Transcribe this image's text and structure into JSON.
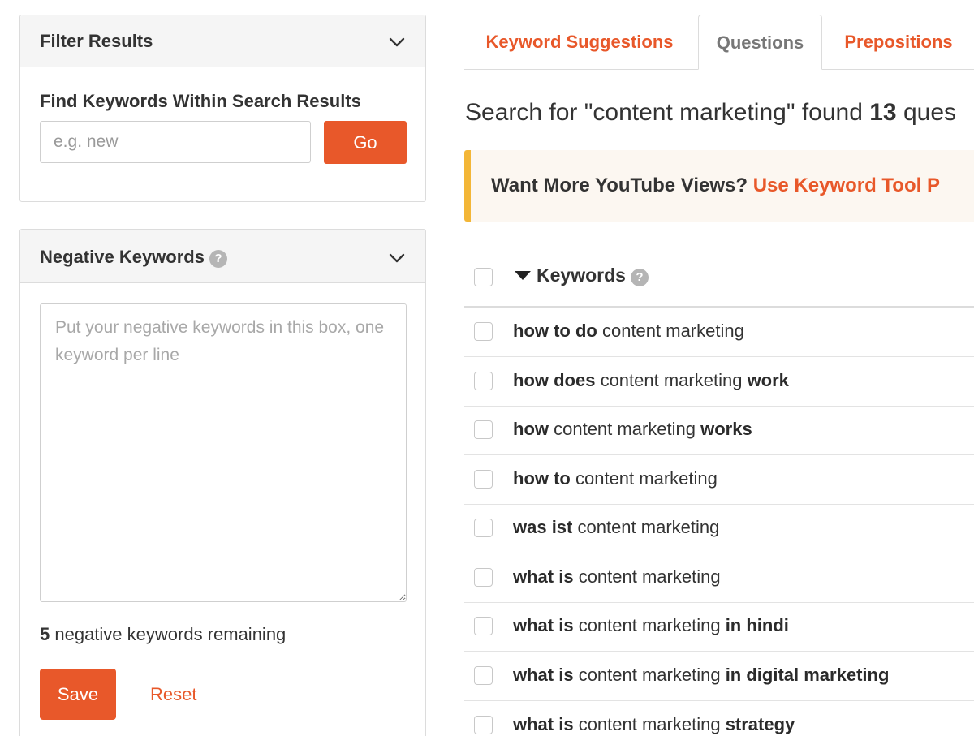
{
  "filter_panel": {
    "title": "Filter Results",
    "find_label": "Find Keywords Within Search Results",
    "input_placeholder": "e.g. new",
    "go_label": "Go"
  },
  "negative_panel": {
    "title": "Negative Keywords",
    "help_glyph": "?",
    "textarea_placeholder": "Put your negative keywords in this box, one keyword per line",
    "remaining_count": "5",
    "remaining_text": " negative keywords remaining",
    "save_label": "Save",
    "reset_label": "Reset"
  },
  "tabs": [
    {
      "label": "Keyword Suggestions",
      "active": false
    },
    {
      "label": "Questions",
      "active": true
    },
    {
      "label": "Prepositions",
      "active": false
    }
  ],
  "summary": {
    "prefix": "Search for \"content marketing\" found ",
    "count": "13",
    "suffix": " ques"
  },
  "promo": {
    "text": "Want More YouTube Views? ",
    "link": "Use Keyword Tool P"
  },
  "table": {
    "header": "Keywords",
    "help_glyph": "?",
    "rows": [
      {
        "pre": "how to do",
        "mid": " content marketing",
        "post": ""
      },
      {
        "pre": "how does",
        "mid": " content marketing ",
        "post": "work"
      },
      {
        "pre": "how",
        "mid": " content marketing ",
        "post": "works"
      },
      {
        "pre": "how to",
        "mid": " content marketing",
        "post": ""
      },
      {
        "pre": "was ist",
        "mid": " content marketing",
        "post": ""
      },
      {
        "pre": "what is",
        "mid": " content marketing",
        "post": ""
      },
      {
        "pre": "what is",
        "mid": " content marketing ",
        "post": "in hindi"
      },
      {
        "pre": "what is",
        "mid": " content marketing ",
        "post": "in digital marketing"
      },
      {
        "pre": "what is",
        "mid": " content marketing ",
        "post": "strategy"
      }
    ]
  },
  "colors": {
    "accent": "#e8582a",
    "promo_border": "#f3b637",
    "panel_header": "#f5f5f5"
  },
  "icons": [
    "chevron-down-icon",
    "help-icon",
    "sort-down-icon"
  ]
}
